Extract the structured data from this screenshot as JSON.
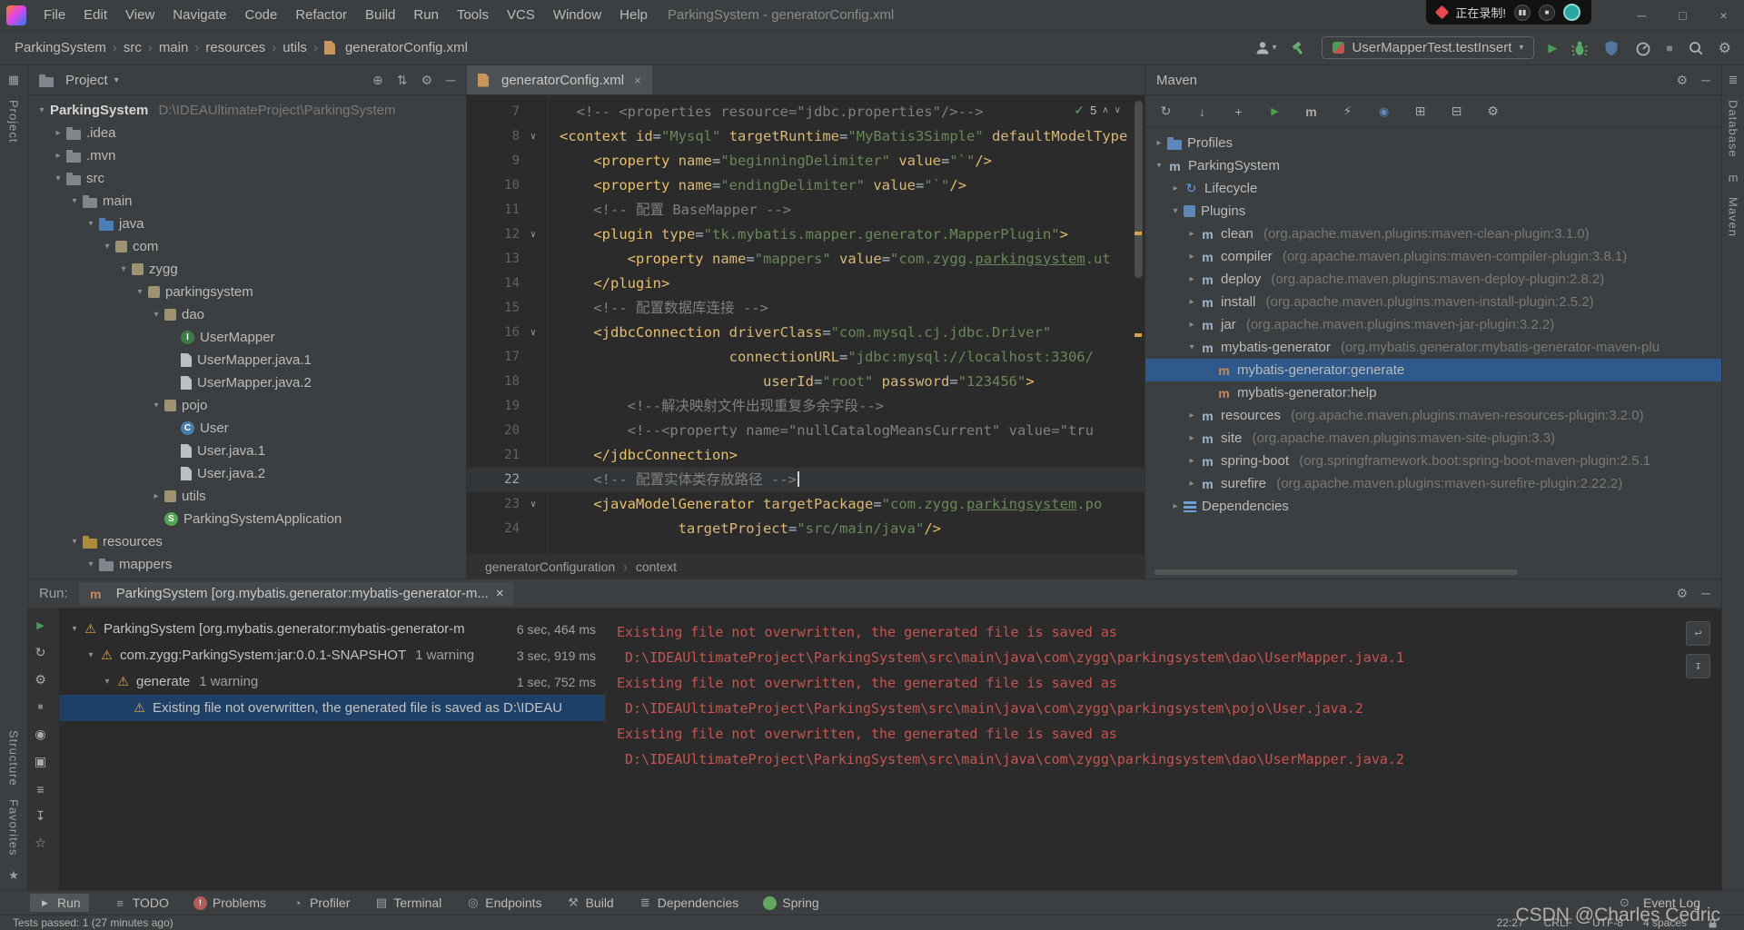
{
  "icons": {
    "glyphs": {
      "down": "▾",
      "right": "▸",
      "chevron": "›",
      "close": "×",
      "check": "✓",
      "up": "∧",
      "downv": "∨",
      "fold": "∨",
      "gear": "⚙",
      "minus": "─",
      "locate": "⊕",
      "updown": "⇅",
      "refresh": "↻",
      "download": "↓",
      "add": "+",
      "playgreen": "▶",
      "playgray": "▶",
      "m": "m",
      "offline": "⚡",
      "skiptests": "◉",
      "expand": "⊞",
      "collapse": "⊟",
      "wrench": "⚙",
      "stopsq": "■",
      "stopgray": "■",
      "pause": "▮▮",
      "star": "★",
      "starline": "☆",
      "eye": "◉",
      "camera": "▣",
      "sliders": "≡",
      "export": "↧",
      "wrap": "↩",
      "scrollend": "↧",
      "todo": "≡",
      "problems": "!",
      "profilerb": "◔",
      "terminal": "▤",
      "endpoints": "◎",
      "build": "⚒",
      "dependenciesb": "≣",
      "eventlog": "⊙",
      "grid": "▦",
      "dbicon": "≣",
      "interface": "I",
      "class": "C",
      "springapp": "S",
      "maven": "m",
      "plugin": "m",
      "goal": "m",
      "lifecycle": "↻",
      "warn": "⚠"
    }
  },
  "title_bar": {
    "menus": [
      "File",
      "Edit",
      "View",
      "Navigate",
      "Code",
      "Refactor",
      "Build",
      "Run",
      "Tools",
      "VCS",
      "Window",
      "Help"
    ],
    "title": "ParkingSystem - generatorConfig.xml",
    "recorder_text": "正在录制!"
  },
  "nav_bar": {
    "breadcrumbs": [
      "ParkingSystem",
      "src",
      "main",
      "resources",
      "utils",
      "generatorConfig.xml"
    ],
    "run_config": "UserMapperTest.testInsert"
  },
  "left_strip": {
    "project": "Project",
    "structure": "Structure",
    "favorites": "Favorites"
  },
  "right_strip": {
    "database": "Database",
    "maven": "Maven"
  },
  "project_panel": {
    "header": "Project",
    "tree": [
      {
        "i": 0,
        "a": "v",
        "ic": "",
        "l": "ParkingSystem",
        "d": " D:\\IDEAUltimateProject\\ParkingSystem",
        "bold": true
      },
      {
        "i": 1,
        "a": "r",
        "ic": "folder",
        "l": ".idea"
      },
      {
        "i": 1,
        "a": "r",
        "ic": "folder",
        "l": ".mvn"
      },
      {
        "i": 1,
        "a": "v",
        "ic": "folder",
        "l": "src"
      },
      {
        "i": 2,
        "a": "v",
        "ic": "folder",
        "l": "main"
      },
      {
        "i": 3,
        "a": "v",
        "ic": "srcroot",
        "l": "java"
      },
      {
        "i": 4,
        "a": "v",
        "ic": "package",
        "l": "com"
      },
      {
        "i": 5,
        "a": "v",
        "ic": "package",
        "l": "zygg"
      },
      {
        "i": 6,
        "a": "v",
        "ic": "package",
        "l": "parkingsystem"
      },
      {
        "i": 7,
        "a": "v",
        "ic": "package",
        "l": "dao"
      },
      {
        "i": 8,
        "a": "",
        "ic": "interface",
        "l": "UserMapper"
      },
      {
        "i": 8,
        "a": "",
        "ic": "file",
        "l": "UserMapper.java.1"
      },
      {
        "i": 8,
        "a": "",
        "ic": "file",
        "l": "UserMapper.java.2"
      },
      {
        "i": 7,
        "a": "v",
        "ic": "package",
        "l": "pojo"
      },
      {
        "i": 8,
        "a": "",
        "ic": "class",
        "l": "User"
      },
      {
        "i": 8,
        "a": "",
        "ic": "file",
        "l": "User.java.1"
      },
      {
        "i": 8,
        "a": "",
        "ic": "file",
        "l": "User.java.2"
      },
      {
        "i": 7,
        "a": "r",
        "ic": "package",
        "l": "utils"
      },
      {
        "i": 7,
        "a": "",
        "ic": "springapp",
        "l": "ParkingSystemApplication"
      },
      {
        "i": 2,
        "a": "v",
        "ic": "resroot",
        "l": "resources"
      },
      {
        "i": 3,
        "a": "v",
        "ic": "folder",
        "l": "mappers"
      }
    ]
  },
  "editor": {
    "tab": "generatorConfig.xml",
    "inspection_count": "5",
    "caret_line": 22,
    "breadcrumb_root": "generatorConfiguration",
    "breadcrumb_child": "context",
    "lines": [
      {
        "n": 7,
        "f": 0,
        "t": [
          [
            "cm",
            "  <!-- <properties resource=\"jdbc.properties\"/>-->"
          ]
        ]
      },
      {
        "n": 8,
        "f": 1,
        "t": [
          [
            "tag",
            "<context"
          ],
          [
            "pl",
            " "
          ],
          [
            "attr",
            "id"
          ],
          [
            "pl",
            "="
          ],
          [
            "str",
            "\"Mysql\""
          ],
          [
            "pl",
            " "
          ],
          [
            "attr",
            "targetRuntime"
          ],
          [
            "pl",
            "="
          ],
          [
            "str",
            "\"MyBatis3Simple\""
          ],
          [
            "pl",
            " "
          ],
          [
            "attr",
            "defaultModelType"
          ]
        ]
      },
      {
        "n": 9,
        "f": 0,
        "t": [
          [
            "pl",
            "    "
          ],
          [
            "tag",
            "<property"
          ],
          [
            "pl",
            " "
          ],
          [
            "attr",
            "name"
          ],
          [
            "pl",
            "="
          ],
          [
            "str",
            "\"beginningDelimiter\""
          ],
          [
            "pl",
            " "
          ],
          [
            "attr",
            "value"
          ],
          [
            "pl",
            "="
          ],
          [
            "str",
            "\"`\""
          ],
          [
            "tag",
            "/>"
          ]
        ]
      },
      {
        "n": 10,
        "f": 0,
        "t": [
          [
            "pl",
            "    "
          ],
          [
            "tag",
            "<property"
          ],
          [
            "pl",
            " "
          ],
          [
            "attr",
            "name"
          ],
          [
            "pl",
            "="
          ],
          [
            "str",
            "\"endingDelimiter\""
          ],
          [
            "pl",
            " "
          ],
          [
            "attr",
            "value"
          ],
          [
            "pl",
            "="
          ],
          [
            "str",
            "\"`\""
          ],
          [
            "tag",
            "/>"
          ]
        ]
      },
      {
        "n": 11,
        "f": 0,
        "t": [
          [
            "pl",
            "    "
          ],
          [
            "cm",
            "<!-- 配置 BaseMapper -->"
          ]
        ]
      },
      {
        "n": 12,
        "f": 1,
        "t": [
          [
            "pl",
            "    "
          ],
          [
            "tag",
            "<plugin"
          ],
          [
            "pl",
            " "
          ],
          [
            "attr",
            "type"
          ],
          [
            "pl",
            "="
          ],
          [
            "str",
            "\"tk.mybatis.mapper.generator.MapperPlugin\""
          ],
          [
            "tag",
            ">"
          ]
        ]
      },
      {
        "n": 13,
        "f": 0,
        "t": [
          [
            "pl",
            "        "
          ],
          [
            "tag",
            "<property"
          ],
          [
            "pl",
            " "
          ],
          [
            "attr",
            "name"
          ],
          [
            "pl",
            "="
          ],
          [
            "str",
            "\"mappers\""
          ],
          [
            "pl",
            " "
          ],
          [
            "attr",
            "value"
          ],
          [
            "pl",
            "="
          ],
          [
            "str",
            "\"com.zygg."
          ],
          [
            "stru",
            "parkingsystem"
          ],
          [
            "str",
            ".ut"
          ]
        ]
      },
      {
        "n": 14,
        "f": 0,
        "t": [
          [
            "pl",
            "    "
          ],
          [
            "tag",
            "</plugin>"
          ]
        ]
      },
      {
        "n": 15,
        "f": 0,
        "t": [
          [
            "pl",
            "    "
          ],
          [
            "cm",
            "<!-- 配置数据库连接 -->"
          ]
        ]
      },
      {
        "n": 16,
        "f": 1,
        "t": [
          [
            "pl",
            "    "
          ],
          [
            "tag",
            "<jdbcConnection"
          ],
          [
            "pl",
            " "
          ],
          [
            "attr",
            "driverClass"
          ],
          [
            "pl",
            "="
          ],
          [
            "str",
            "\"com.mysql.cj.jdbc.Driver\""
          ]
        ]
      },
      {
        "n": 17,
        "f": 0,
        "t": [
          [
            "pl",
            "                    "
          ],
          [
            "attr",
            "connectionURL"
          ],
          [
            "pl",
            "="
          ],
          [
            "str",
            "\"jdbc:mysql://localhost:3306/"
          ]
        ]
      },
      {
        "n": 18,
        "f": 0,
        "t": [
          [
            "pl",
            "                        "
          ],
          [
            "attr",
            "userId"
          ],
          [
            "pl",
            "="
          ],
          [
            "str",
            "\"root\""
          ],
          [
            "pl",
            " "
          ],
          [
            "attr",
            "password"
          ],
          [
            "pl",
            "="
          ],
          [
            "str",
            "\"123456\""
          ],
          [
            "tag",
            ">"
          ]
        ]
      },
      {
        "n": 19,
        "f": 0,
        "t": [
          [
            "pl",
            "        "
          ],
          [
            "cm",
            "<!--解决映射文件出现重复多余字段-->"
          ]
        ]
      },
      {
        "n": 20,
        "f": 0,
        "t": [
          [
            "pl",
            "        "
          ],
          [
            "cm",
            "<!--<property name=\"nullCatalogMeansCurrent\" value=\"tru"
          ]
        ]
      },
      {
        "n": 21,
        "f": 0,
        "t": [
          [
            "pl",
            "    "
          ],
          [
            "tag",
            "</jdbcConnection>"
          ]
        ]
      },
      {
        "n": 22,
        "f": 0,
        "t": [
          [
            "pl",
            "    "
          ],
          [
            "cm",
            "<!-- 配置实体类存放路径 -->"
          ]
        ]
      },
      {
        "n": 23,
        "f": 1,
        "t": [
          [
            "pl",
            "    "
          ],
          [
            "tag",
            "<javaModelGenerator"
          ],
          [
            "pl",
            " "
          ],
          [
            "attr",
            "targetPackage"
          ],
          [
            "pl",
            "="
          ],
          [
            "str",
            "\"com.zygg."
          ],
          [
            "stru",
            "parkingsystem"
          ],
          [
            "str",
            ".po"
          ]
        ]
      },
      {
        "n": 24,
        "f": 0,
        "t": [
          [
            "pl",
            "              "
          ],
          [
            "attr",
            "targetProject"
          ],
          [
            "pl",
            "="
          ],
          [
            "str",
            "\"src/main/java\""
          ],
          [
            "tag",
            "/>"
          ]
        ]
      }
    ]
  },
  "maven_panel": {
    "header": "Maven",
    "toolbar": [
      "refresh",
      "download",
      "add",
      "playgreen",
      "m",
      "offline",
      "skiptests",
      "expand",
      "collapse",
      "wrench"
    ],
    "tree": [
      {
        "i": 0,
        "a": "r",
        "ic": "profiles",
        "l": "Profiles"
      },
      {
        "i": 0,
        "a": "v",
        "ic": "maven",
        "l": "ParkingSystem"
      },
      {
        "i": 1,
        "a": "r",
        "ic": "lifecycle",
        "l": "Lifecycle"
      },
      {
        "i": 1,
        "a": "v",
        "ic": "plugins",
        "l": "Plugins"
      },
      {
        "i": 2,
        "a": "r",
        "ic": "plugin",
        "l": "clean",
        "d": " (org.apache.maven.plugins:maven-clean-plugin:3.1.0)"
      },
      {
        "i": 2,
        "a": "r",
        "ic": "plugin",
        "l": "compiler",
        "d": " (org.apache.maven.plugins:maven-compiler-plugin:3.8.1)"
      },
      {
        "i": 2,
        "a": "r",
        "ic": "plugin",
        "l": "deploy",
        "d": " (org.apache.maven.plugins:maven-deploy-plugin:2.8.2)"
      },
      {
        "i": 2,
        "a": "r",
        "ic": "plugin",
        "l": "install",
        "d": " (org.apache.maven.plugins:maven-install-plugin:2.5.2)"
      },
      {
        "i": 2,
        "a": "r",
        "ic": "plugin",
        "l": "jar",
        "d": " (org.apache.maven.plugins:maven-jar-plugin:3.2.2)"
      },
      {
        "i": 2,
        "a": "v",
        "ic": "plugin",
        "l": "mybatis-generator",
        "d": " (org.mybatis.generator:mybatis-generator-maven-plu"
      },
      {
        "i": 3,
        "a": "",
        "ic": "goal",
        "l": "mybatis-generator:generate",
        "sel": true
      },
      {
        "i": 3,
        "a": "",
        "ic": "goal",
        "l": "mybatis-generator:help"
      },
      {
        "i": 2,
        "a": "r",
        "ic": "plugin",
        "l": "resources",
        "d": " (org.apache.maven.plugins:maven-resources-plugin:3.2.0)"
      },
      {
        "i": 2,
        "a": "r",
        "ic": "plugin",
        "l": "site",
        "d": " (org.apache.maven.plugins:maven-site-plugin:3.3)"
      },
      {
        "i": 2,
        "a": "r",
        "ic": "plugin",
        "l": "spring-boot",
        "d": " (org.springframework.boot:spring-boot-maven-plugin:2.5.1"
      },
      {
        "i": 2,
        "a": "r",
        "ic": "plugin",
        "l": "surefire",
        "d": " (org.apache.maven.plugins:maven-surefire-plugin:2.22.2)"
      },
      {
        "i": 1,
        "a": "r",
        "ic": "dependencies",
        "l": "Dependencies"
      }
    ]
  },
  "run_panel": {
    "label": "Run:",
    "tab": "ParkingSystem [org.mybatis.generator:mybatis-generator-m...",
    "strip": [
      "playgreen",
      "refresh",
      "wrench",
      "stopgray",
      "eye",
      "camera",
      "sliders",
      "export",
      "starline"
    ],
    "tree": [
      {
        "i": 0,
        "a": "v",
        "warn": true,
        "l": "ParkingSystem [org.mybatis.generator:mybatis-generator-m",
        "time": "6 sec, 464 ms"
      },
      {
        "i": 1,
        "a": "v",
        "warn": true,
        "l": "com.zygg:ParkingSystem:jar:0.0.1-SNAPSHOT",
        "sfx": "1 warning",
        "time": "3 sec, 919 ms"
      },
      {
        "i": 2,
        "a": "v",
        "warn": true,
        "l": "generate",
        "sfx": "1 warning",
        "time": "1 sec, 752 ms"
      },
      {
        "i": 3,
        "a": "",
        "warn": true,
        "l": "Existing file not overwritten, the generated file is saved as D:\\IDEAU",
        "sel": true
      }
    ],
    "console": [
      "Existing file not overwritten, the generated file is saved as",
      " D:\\IDEAUltimateProject\\ParkingSystem\\src\\main\\java\\com\\zygg\\parkingsystem\\dao\\UserMapper.java.1",
      "Existing file not overwritten, the generated file is saved as",
      " D:\\IDEAUltimateProject\\ParkingSystem\\src\\main\\java\\com\\zygg\\parkingsystem\\pojo\\User.java.2",
      "Existing file not overwritten, the generated file is saved as",
      " D:\\IDEAUltimateProject\\ParkingSystem\\src\\main\\java\\com\\zygg\\parkingsystem\\dao\\UserMapper.java.2"
    ]
  },
  "bottom_bar": {
    "items": [
      {
        "l": "Run",
        "ic": "playgray",
        "active": true
      },
      {
        "l": "TODO",
        "ic": "todo"
      },
      {
        "l": "Problems",
        "ic": "problems"
      },
      {
        "l": "Profiler",
        "ic": "profilerb"
      },
      {
        "l": "Terminal",
        "ic": "terminal"
      },
      {
        "l": "Endpoints",
        "ic": "endpoints"
      },
      {
        "l": "Build",
        "ic": "build"
      },
      {
        "l": "Dependencies",
        "ic": "dependenciesb"
      },
      {
        "l": "Spring",
        "ic": "spring"
      }
    ],
    "right": "Event Log"
  },
  "status_bar": {
    "left": "Tests passed: 1 (27 minutes ago)",
    "time": "22:27",
    "line_ending": "CRLF",
    "encoding": "UTF-8",
    "indent": "4 spaces"
  },
  "watermark": "CSDN @Charles Cedric"
}
